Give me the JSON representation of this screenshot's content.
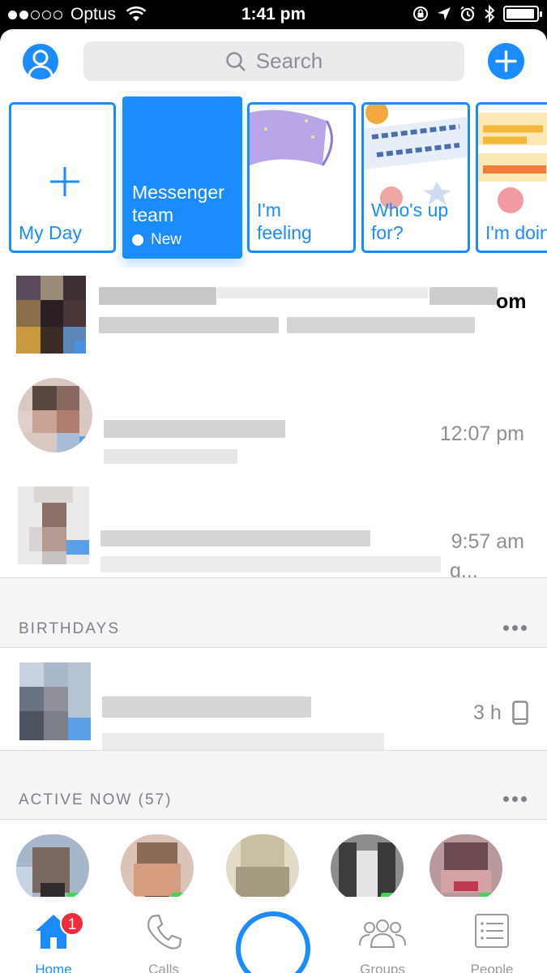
{
  "status_bar": {
    "carrier": "Optus",
    "time": "1:41 pm"
  },
  "search": {
    "placeholder": "Search"
  },
  "stories": [
    {
      "label": "My Day"
    },
    {
      "label": "Messenger\nteam",
      "tag": "New"
    },
    {
      "label": "I'm\nfeeling"
    },
    {
      "label": "Who's up\nfor?"
    },
    {
      "label": "I'm doin"
    }
  ],
  "conversations": [
    {
      "time_fragment": "om"
    },
    {
      "time": "12:07 pm"
    },
    {
      "time": "9:57 am",
      "preview_fragment": "g..."
    }
  ],
  "birthdays": {
    "header": "BIRTHDAYS",
    "rows": [
      {
        "time": "3 h"
      }
    ]
  },
  "active_now": {
    "header": "ACTIVE NOW (57)"
  },
  "tabs": [
    {
      "label": "Home",
      "badge": "1"
    },
    {
      "label": "Calls"
    },
    {
      "label": "Groups"
    },
    {
      "label": "People"
    }
  ],
  "colors": {
    "accent": "#1a8cff",
    "badge": "#f02b3c",
    "online": "#44d35b"
  }
}
